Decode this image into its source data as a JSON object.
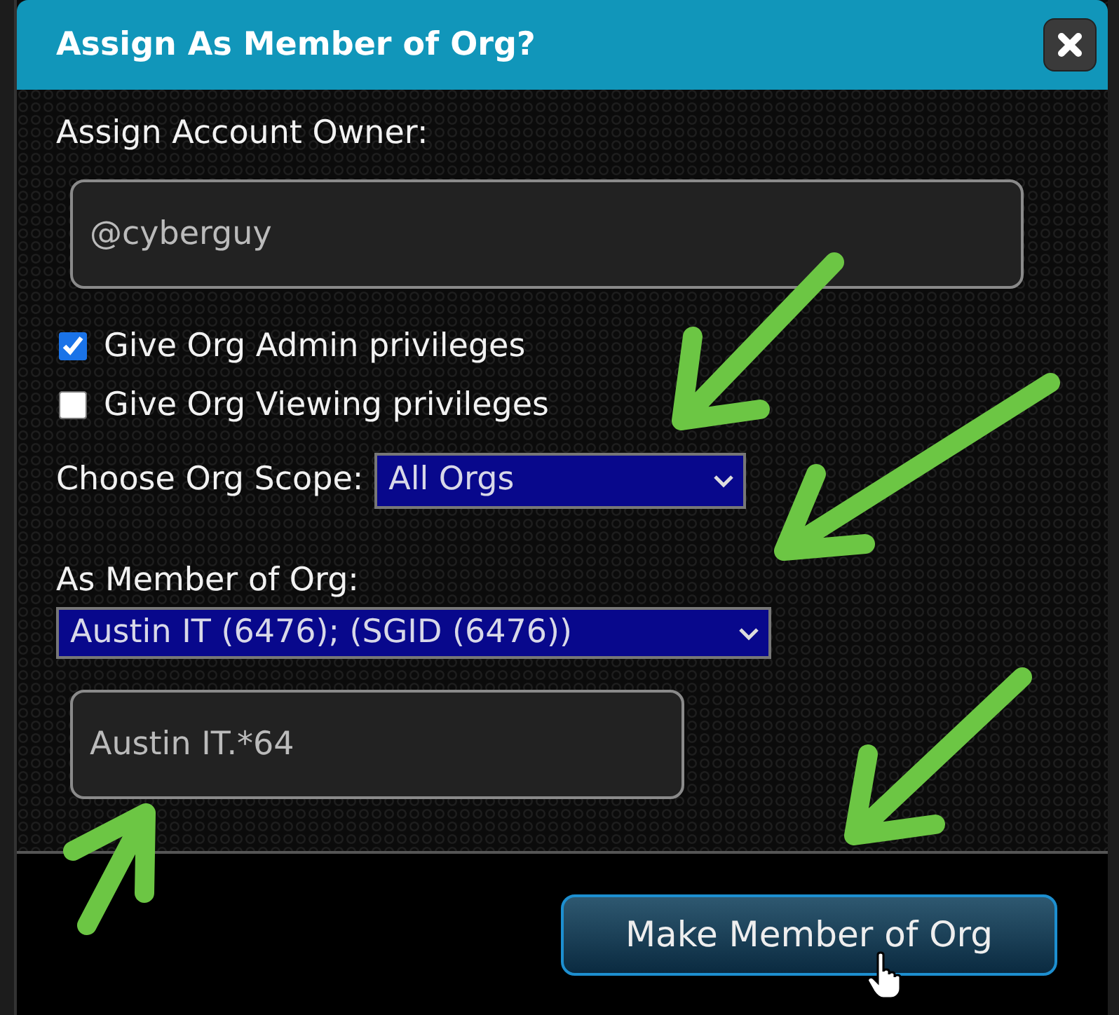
{
  "dialog": {
    "title": "Assign As Member of Org?"
  },
  "owner": {
    "label": "Assign Account Owner:",
    "value": "@cyberguy"
  },
  "checkboxes": [
    {
      "label": "Give Org Admin privileges",
      "checked": true
    },
    {
      "label": "Give Org Viewing privileges",
      "checked": false
    }
  ],
  "scope": {
    "label": "Choose Org Scope:",
    "value": "All Orgs"
  },
  "member": {
    "label": "As Member of Org:",
    "value": "Austin IT (6476); (SGID (6476))",
    "filter": "Austin IT.*64"
  },
  "button": {
    "label": "Make Member of Org"
  }
}
